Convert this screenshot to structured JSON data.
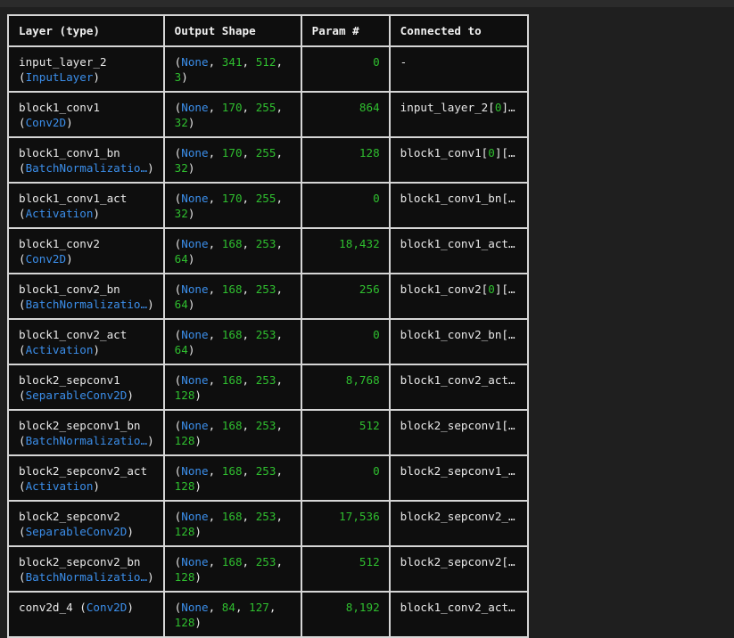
{
  "headers": {
    "layer": "Layer (type)",
    "shape": "Output Shape",
    "params": "Param #",
    "connected": "Connected to"
  },
  "rows": [
    {
      "name": "input_layer_2",
      "type": "InputLayer",
      "shape": [
        "None",
        "341",
        "512",
        "3"
      ],
      "params": "0",
      "connected": "-"
    },
    {
      "name": "block1_conv1",
      "type": "Conv2D",
      "shape": [
        "None",
        "170",
        "255",
        "32"
      ],
      "params": "864",
      "connected": "input_layer_2[0]…"
    },
    {
      "name": "block1_conv1_bn",
      "type": "BatchNormalizatio…",
      "shape": [
        "None",
        "170",
        "255",
        "32"
      ],
      "params": "128",
      "connected": "block1_conv1[0][…"
    },
    {
      "name": "block1_conv1_act",
      "type": "Activation",
      "shape": [
        "None",
        "170",
        "255",
        "32"
      ],
      "params": "0",
      "connected": "block1_conv1_bn[…"
    },
    {
      "name": "block1_conv2",
      "type": "Conv2D",
      "shape": [
        "None",
        "168",
        "253",
        "64"
      ],
      "params": "18,432",
      "connected": "block1_conv1_act…"
    },
    {
      "name": "block1_conv2_bn",
      "type": "BatchNormalizatio…",
      "shape": [
        "None",
        "168",
        "253",
        "64"
      ],
      "params": "256",
      "connected": "block1_conv2[0][…"
    },
    {
      "name": "block1_conv2_act",
      "type": "Activation",
      "shape": [
        "None",
        "168",
        "253",
        "64"
      ],
      "params": "0",
      "connected": "block1_conv2_bn[…"
    },
    {
      "name": "block2_sepconv1",
      "type": "SeparableConv2D",
      "shape": [
        "None",
        "168",
        "253",
        "128"
      ],
      "params": "8,768",
      "connected": "block1_conv2_act…"
    },
    {
      "name": "block2_sepconv1_bn",
      "type": "BatchNormalizatio…",
      "shape": [
        "None",
        "168",
        "253",
        "128"
      ],
      "params": "512",
      "connected": "block2_sepconv1[…"
    },
    {
      "name": "block2_sepconv2_act",
      "type": "Activation",
      "shape": [
        "None",
        "168",
        "253",
        "128"
      ],
      "params": "0",
      "connected": "block2_sepconv1_…"
    },
    {
      "name": "block2_sepconv2",
      "type": "SeparableConv2D",
      "shape": [
        "None",
        "168",
        "253",
        "128"
      ],
      "params": "17,536",
      "connected": "block2_sepconv2_…"
    },
    {
      "name": "block2_sepconv2_bn",
      "type": "BatchNormalizatio…",
      "shape": [
        "None",
        "168",
        "253",
        "128"
      ],
      "params": "512",
      "connected": "block2_sepconv2[…"
    },
    {
      "name": "conv2d_4",
      "type": "Conv2D",
      "shape": [
        "None",
        "84",
        "127",
        "128"
      ],
      "params": "8,192",
      "connected": "block1_conv2_act…",
      "inline_type": true
    }
  ],
  "colors": {
    "type_blue": "#3b8eea",
    "number_green": "#2fbf2f",
    "text": "#e8e8e8",
    "border": "#d6d6d6",
    "cell_bg": "#0e0e0e",
    "page_bg": "#1f1f1f"
  }
}
